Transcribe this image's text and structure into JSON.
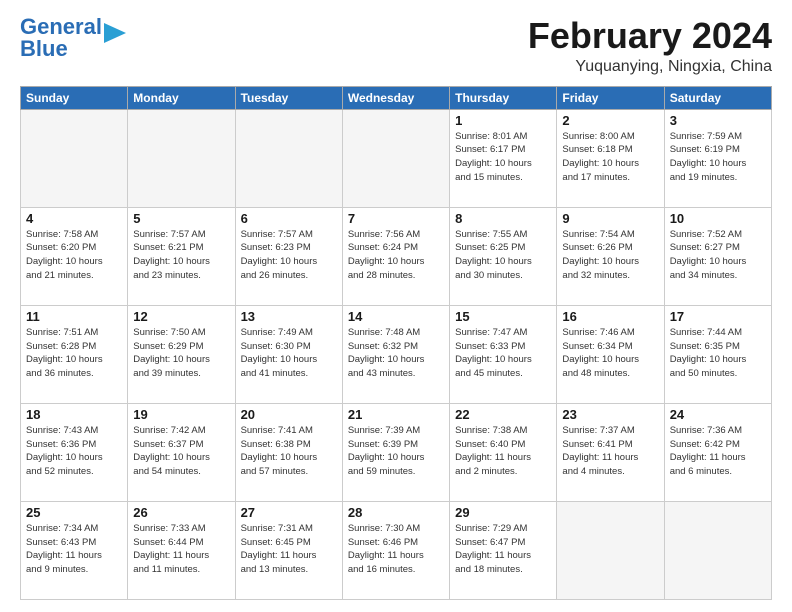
{
  "header": {
    "logo_line1": "General",
    "logo_line2": "Blue",
    "title": "February 2024",
    "subtitle": "Yuquanying, Ningxia, China"
  },
  "weekdays": [
    "Sunday",
    "Monday",
    "Tuesday",
    "Wednesday",
    "Thursday",
    "Friday",
    "Saturday"
  ],
  "weeks": [
    [
      {
        "day": "",
        "info": ""
      },
      {
        "day": "",
        "info": ""
      },
      {
        "day": "",
        "info": ""
      },
      {
        "day": "",
        "info": ""
      },
      {
        "day": "1",
        "info": "Sunrise: 8:01 AM\nSunset: 6:17 PM\nDaylight: 10 hours\nand 15 minutes."
      },
      {
        "day": "2",
        "info": "Sunrise: 8:00 AM\nSunset: 6:18 PM\nDaylight: 10 hours\nand 17 minutes."
      },
      {
        "day": "3",
        "info": "Sunrise: 7:59 AM\nSunset: 6:19 PM\nDaylight: 10 hours\nand 19 minutes."
      }
    ],
    [
      {
        "day": "4",
        "info": "Sunrise: 7:58 AM\nSunset: 6:20 PM\nDaylight: 10 hours\nand 21 minutes."
      },
      {
        "day": "5",
        "info": "Sunrise: 7:57 AM\nSunset: 6:21 PM\nDaylight: 10 hours\nand 23 minutes."
      },
      {
        "day": "6",
        "info": "Sunrise: 7:57 AM\nSunset: 6:23 PM\nDaylight: 10 hours\nand 26 minutes."
      },
      {
        "day": "7",
        "info": "Sunrise: 7:56 AM\nSunset: 6:24 PM\nDaylight: 10 hours\nand 28 minutes."
      },
      {
        "day": "8",
        "info": "Sunrise: 7:55 AM\nSunset: 6:25 PM\nDaylight: 10 hours\nand 30 minutes."
      },
      {
        "day": "9",
        "info": "Sunrise: 7:54 AM\nSunset: 6:26 PM\nDaylight: 10 hours\nand 32 minutes."
      },
      {
        "day": "10",
        "info": "Sunrise: 7:52 AM\nSunset: 6:27 PM\nDaylight: 10 hours\nand 34 minutes."
      }
    ],
    [
      {
        "day": "11",
        "info": "Sunrise: 7:51 AM\nSunset: 6:28 PM\nDaylight: 10 hours\nand 36 minutes."
      },
      {
        "day": "12",
        "info": "Sunrise: 7:50 AM\nSunset: 6:29 PM\nDaylight: 10 hours\nand 39 minutes."
      },
      {
        "day": "13",
        "info": "Sunrise: 7:49 AM\nSunset: 6:30 PM\nDaylight: 10 hours\nand 41 minutes."
      },
      {
        "day": "14",
        "info": "Sunrise: 7:48 AM\nSunset: 6:32 PM\nDaylight: 10 hours\nand 43 minutes."
      },
      {
        "day": "15",
        "info": "Sunrise: 7:47 AM\nSunset: 6:33 PM\nDaylight: 10 hours\nand 45 minutes."
      },
      {
        "day": "16",
        "info": "Sunrise: 7:46 AM\nSunset: 6:34 PM\nDaylight: 10 hours\nand 48 minutes."
      },
      {
        "day": "17",
        "info": "Sunrise: 7:44 AM\nSunset: 6:35 PM\nDaylight: 10 hours\nand 50 minutes."
      }
    ],
    [
      {
        "day": "18",
        "info": "Sunrise: 7:43 AM\nSunset: 6:36 PM\nDaylight: 10 hours\nand 52 minutes."
      },
      {
        "day": "19",
        "info": "Sunrise: 7:42 AM\nSunset: 6:37 PM\nDaylight: 10 hours\nand 54 minutes."
      },
      {
        "day": "20",
        "info": "Sunrise: 7:41 AM\nSunset: 6:38 PM\nDaylight: 10 hours\nand 57 minutes."
      },
      {
        "day": "21",
        "info": "Sunrise: 7:39 AM\nSunset: 6:39 PM\nDaylight: 10 hours\nand 59 minutes."
      },
      {
        "day": "22",
        "info": "Sunrise: 7:38 AM\nSunset: 6:40 PM\nDaylight: 11 hours\nand 2 minutes."
      },
      {
        "day": "23",
        "info": "Sunrise: 7:37 AM\nSunset: 6:41 PM\nDaylight: 11 hours\nand 4 minutes."
      },
      {
        "day": "24",
        "info": "Sunrise: 7:36 AM\nSunset: 6:42 PM\nDaylight: 11 hours\nand 6 minutes."
      }
    ],
    [
      {
        "day": "25",
        "info": "Sunrise: 7:34 AM\nSunset: 6:43 PM\nDaylight: 11 hours\nand 9 minutes."
      },
      {
        "day": "26",
        "info": "Sunrise: 7:33 AM\nSunset: 6:44 PM\nDaylight: 11 hours\nand 11 minutes."
      },
      {
        "day": "27",
        "info": "Sunrise: 7:31 AM\nSunset: 6:45 PM\nDaylight: 11 hours\nand 13 minutes."
      },
      {
        "day": "28",
        "info": "Sunrise: 7:30 AM\nSunset: 6:46 PM\nDaylight: 11 hours\nand 16 minutes."
      },
      {
        "day": "29",
        "info": "Sunrise: 7:29 AM\nSunset: 6:47 PM\nDaylight: 11 hours\nand 18 minutes."
      },
      {
        "day": "",
        "info": ""
      },
      {
        "day": "",
        "info": ""
      }
    ]
  ]
}
